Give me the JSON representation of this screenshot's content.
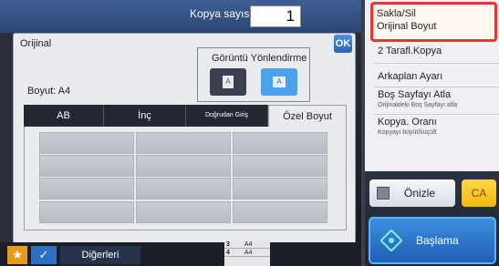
{
  "header": {
    "copy_count_label": "Kopya sayısı",
    "copy_count_value": "1"
  },
  "dialog": {
    "title": "Orijinal",
    "ok_label": "OK",
    "orientation": {
      "title": "Görüntü Yönlendirme",
      "option_a_glyph": "A",
      "option_b_glyph": "A"
    },
    "size_label": "Boyut: A4",
    "tabs": [
      {
        "label": "AB"
      },
      {
        "label": "İnç"
      },
      {
        "label": "Doğrudan Giriş"
      },
      {
        "label": "Özel Boyut"
      }
    ]
  },
  "right_panel": {
    "item1_line1": "Sakla/Sil",
    "item1_line2": "Orijinal Boyut",
    "item2": "2 Tarafl.Kopya",
    "item3": "Arkaplan Ayarı",
    "item4": "Boş Sayfayı Atla",
    "item4_sub": "Orijinaldeki Boş Sayfayı atla",
    "item5": "Kopya. Oranı",
    "item5_sub": "Kopyayı büyüt/küçült",
    "preview_label": "Önizle",
    "ca_label": "CA",
    "start_label": "Başlama"
  },
  "bottom_bar": {
    "star_glyph": "★",
    "check_glyph": "✓",
    "others_label": "Diğerleri",
    "job_rows": [
      {
        "num": "3",
        "size": "A4"
      },
      {
        "num": "4",
        "size": "A4"
      }
    ]
  }
}
